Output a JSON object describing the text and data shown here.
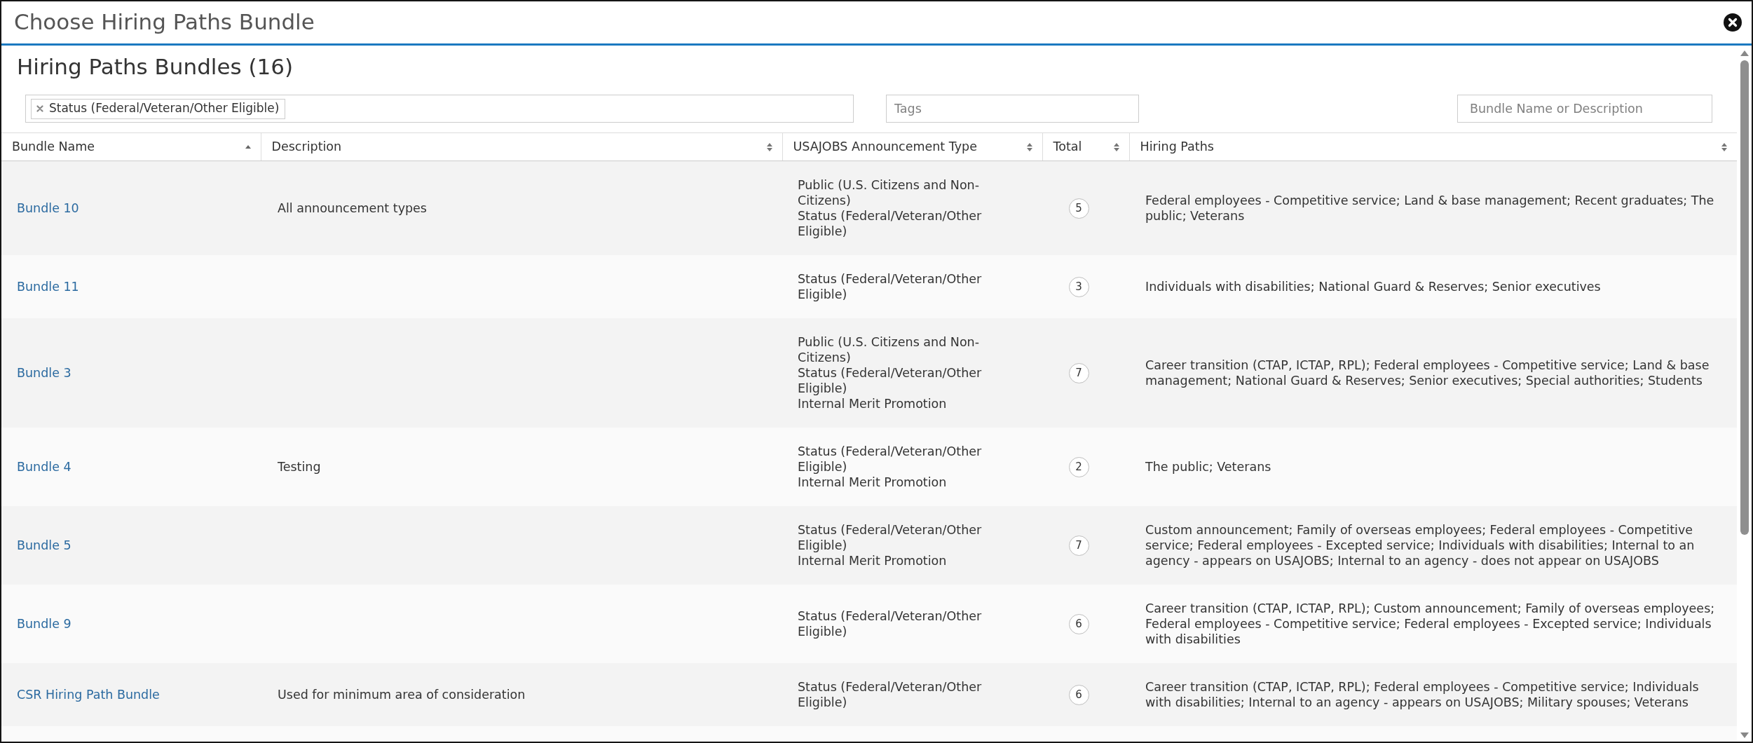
{
  "window": {
    "title": "Choose Hiring Paths Bundle"
  },
  "heading": "Hiring Paths Bundles (16)",
  "filters": {
    "status_tags": [
      {
        "label": "Status (Federal/Veteran/Other Eligible)"
      }
    ],
    "tags": {
      "placeholder": "Tags"
    },
    "search": {
      "placeholder": "Bundle Name or Description"
    }
  },
  "table": {
    "columns": [
      {
        "label": "Bundle Name",
        "sorted": true
      },
      {
        "label": "Description",
        "sorted": false
      },
      {
        "label": "USAJOBS Announcement Type",
        "sorted": false
      },
      {
        "label": "Total",
        "sorted": false
      },
      {
        "label": "Hiring Paths",
        "sorted": false
      }
    ],
    "rows": [
      {
        "bundle_name": "Bundle 10",
        "description": "All announcement types",
        "announcement_types": [
          "Public (U.S. Citizens and Non-Citizens)",
          "Status (Federal/Veteran/Other Eligible)"
        ],
        "total": "5",
        "hiring_paths": "Federal employees - Competitive service; Land & base management; Recent graduates; The public; Veterans"
      },
      {
        "bundle_name": "Bundle 11",
        "announcement_types": [
          "Status (Federal/Veteran/Other Eligible)"
        ],
        "total": "3",
        "hiring_paths": "Individuals with disabilities; National Guard & Reserves; Senior executives"
      },
      {
        "bundle_name": "Bundle 3",
        "announcement_types": [
          "Public (U.S. Citizens and Non-Citizens)",
          "Status (Federal/Veteran/Other Eligible)",
          "Internal Merit Promotion"
        ],
        "total": "7",
        "hiring_paths": "Career transition (CTAP, ICTAP, RPL); Federal employees - Competitive service; Land & base management; National Guard & Reserves; Senior executives; Special authorities; Students"
      },
      {
        "bundle_name": "Bundle 4",
        "description": "Testing",
        "announcement_types": [
          "Status (Federal/Veteran/Other Eligible)",
          "Internal Merit Promotion"
        ],
        "total": "2",
        "hiring_paths": "The public; Veterans"
      },
      {
        "bundle_name": "Bundle 5",
        "announcement_types": [
          "Status (Federal/Veteran/Other Eligible)",
          "Internal Merit Promotion"
        ],
        "total": "7",
        "hiring_paths": "Custom announcement; Family of overseas employees; Federal employees - Competitive service; Federal employees - Excepted service; Individuals with disabilities; Internal to an agency - appears on USAJOBS; Internal to an agency - does not appear on USAJOBS"
      },
      {
        "bundle_name": "Bundle 9",
        "announcement_types": [
          "Status (Federal/Veteran/Other Eligible)"
        ],
        "total": "6",
        "hiring_paths": "Career transition (CTAP, ICTAP, RPL); Custom announcement; Family of overseas employees; Federal employees - Competitive service; Federal employees - Excepted service; Individuals with disabilities"
      },
      {
        "bundle_name": "CSR Hiring Path Bundle",
        "description": "Used for minimum area of consideration",
        "announcement_types": [
          "Status (Federal/Veteran/Other Eligible)"
        ],
        "total": "6",
        "hiring_paths": "Career transition (CTAP, ICTAP, RPL); Federal employees - Competitive service; Individuals with disabilities; Internal to an agency - appears on USAJOBS; Military spouses; Veterans"
      }
    ]
  }
}
